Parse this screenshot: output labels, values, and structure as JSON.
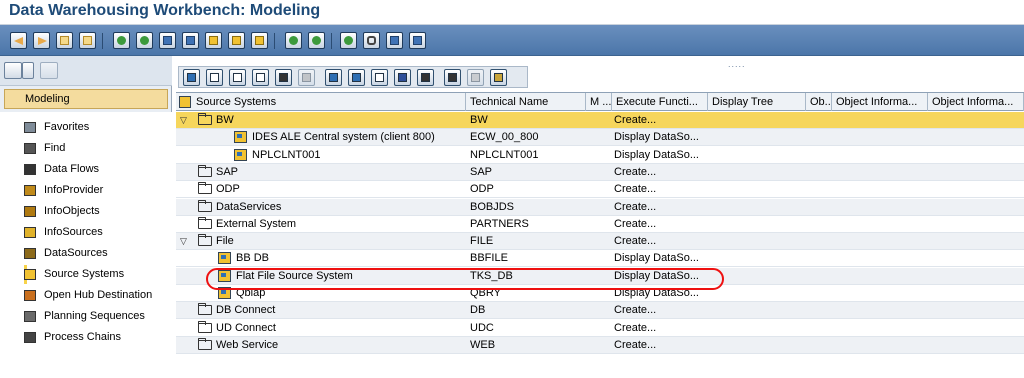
{
  "window": {
    "title": "Data Warehousing Workbench: Modeling"
  },
  "toolbar": {
    "icons": [
      "back-icon",
      "forward-icon",
      "window-icon",
      "tree-icon",
      "connect-icon",
      "data-icon",
      "object-icon",
      "transport-icon",
      "monitor-icon",
      "activate-icon",
      "checklist-icon",
      "wand-icon",
      "graphic-icon",
      "table-icon",
      "chain-icon",
      "display-icon",
      "doc-icon",
      "settings-icon"
    ]
  },
  "left": {
    "section_label": "Modeling",
    "nav": [
      {
        "label": "Favorites",
        "icon": "favorites-icon"
      },
      {
        "label": "Find",
        "icon": "binoculars-icon"
      },
      {
        "label": "Data Flows",
        "icon": "dataflow-icon"
      },
      {
        "label": "InfoProvider",
        "icon": "infoprovider-icon"
      },
      {
        "label": "InfoObjects",
        "icon": "infoobject-icon"
      },
      {
        "label": "InfoSources",
        "icon": "infosource-icon"
      },
      {
        "label": "DataSources",
        "icon": "datasource-icon"
      },
      {
        "label": "Source Systems",
        "icon": "source-system-icon",
        "selected": true
      },
      {
        "label": "Open Hub Destination",
        "icon": "openhub-icon"
      },
      {
        "label": "Planning Sequences",
        "icon": "planning-icon"
      },
      {
        "label": "Process Chains",
        "icon": "chain-icon"
      }
    ]
  },
  "grid": {
    "columns": [
      "Source Systems",
      "Technical Name",
      "M ...",
      "Execute Functi...",
      "Display Tree",
      "Ob...",
      "Object Informa...",
      "Object Informa..."
    ],
    "rows": [
      {
        "level": 0,
        "expander": "▽",
        "icon": "folder",
        "name": "BW",
        "tech": "BW",
        "exec": "Create...",
        "highlight": true
      },
      {
        "level": 2,
        "expander": "",
        "icon": "source",
        "name": "IDES ALE Central system (client 800)",
        "tech": "ECW_00_800",
        "exec": "Display DataSo..."
      },
      {
        "level": 2,
        "expander": "",
        "icon": "source",
        "name": "NPLCLNT001",
        "tech": "NPLCLNT001",
        "exec": "Display DataSo..."
      },
      {
        "level": 0,
        "expander": "",
        "icon": "folder",
        "name": "SAP",
        "tech": "SAP",
        "exec": "Create..."
      },
      {
        "level": 0,
        "expander": "",
        "icon": "folder",
        "name": "ODP",
        "tech": "ODP",
        "exec": "Create..."
      },
      {
        "level": 0,
        "expander": "",
        "icon": "folder",
        "name": "DataServices",
        "tech": "BOBJDS",
        "exec": "Create..."
      },
      {
        "level": 0,
        "expander": "",
        "icon": "folder",
        "name": "External System",
        "tech": "PARTNERS",
        "exec": "Create..."
      },
      {
        "level": 0,
        "expander": "▽",
        "icon": "folder",
        "name": "File",
        "tech": "FILE",
        "exec": "Create..."
      },
      {
        "level": 1,
        "expander": "",
        "icon": "source",
        "name": "BB DB",
        "tech": "BBFILE",
        "exec": "Display DataSo..."
      },
      {
        "level": 1,
        "expander": "",
        "icon": "source",
        "name": "Flat File Source System",
        "tech": "TKS_DB",
        "exec": "Display DataSo..."
      },
      {
        "level": 1,
        "expander": "",
        "icon": "source",
        "name": "Qblap",
        "tech": "QBRY",
        "exec": "Display DataSo..."
      },
      {
        "level": 0,
        "expander": "",
        "icon": "folder",
        "name": "DB Connect",
        "tech": "DB",
        "exec": "Create..."
      },
      {
        "level": 0,
        "expander": "",
        "icon": "folder",
        "name": "UD Connect",
        "tech": "UDC",
        "exec": "Create..."
      },
      {
        "level": 0,
        "expander": "",
        "icon": "folder",
        "name": "Web Service",
        "tech": "WEB",
        "exec": "Create..."
      }
    ]
  },
  "colors": {
    "title": "#1e4b78",
    "toolbar": "#4b76a9",
    "highlight": "#f6d65c",
    "selected_nav": "#f7d34a",
    "annotation": "#e11111"
  }
}
